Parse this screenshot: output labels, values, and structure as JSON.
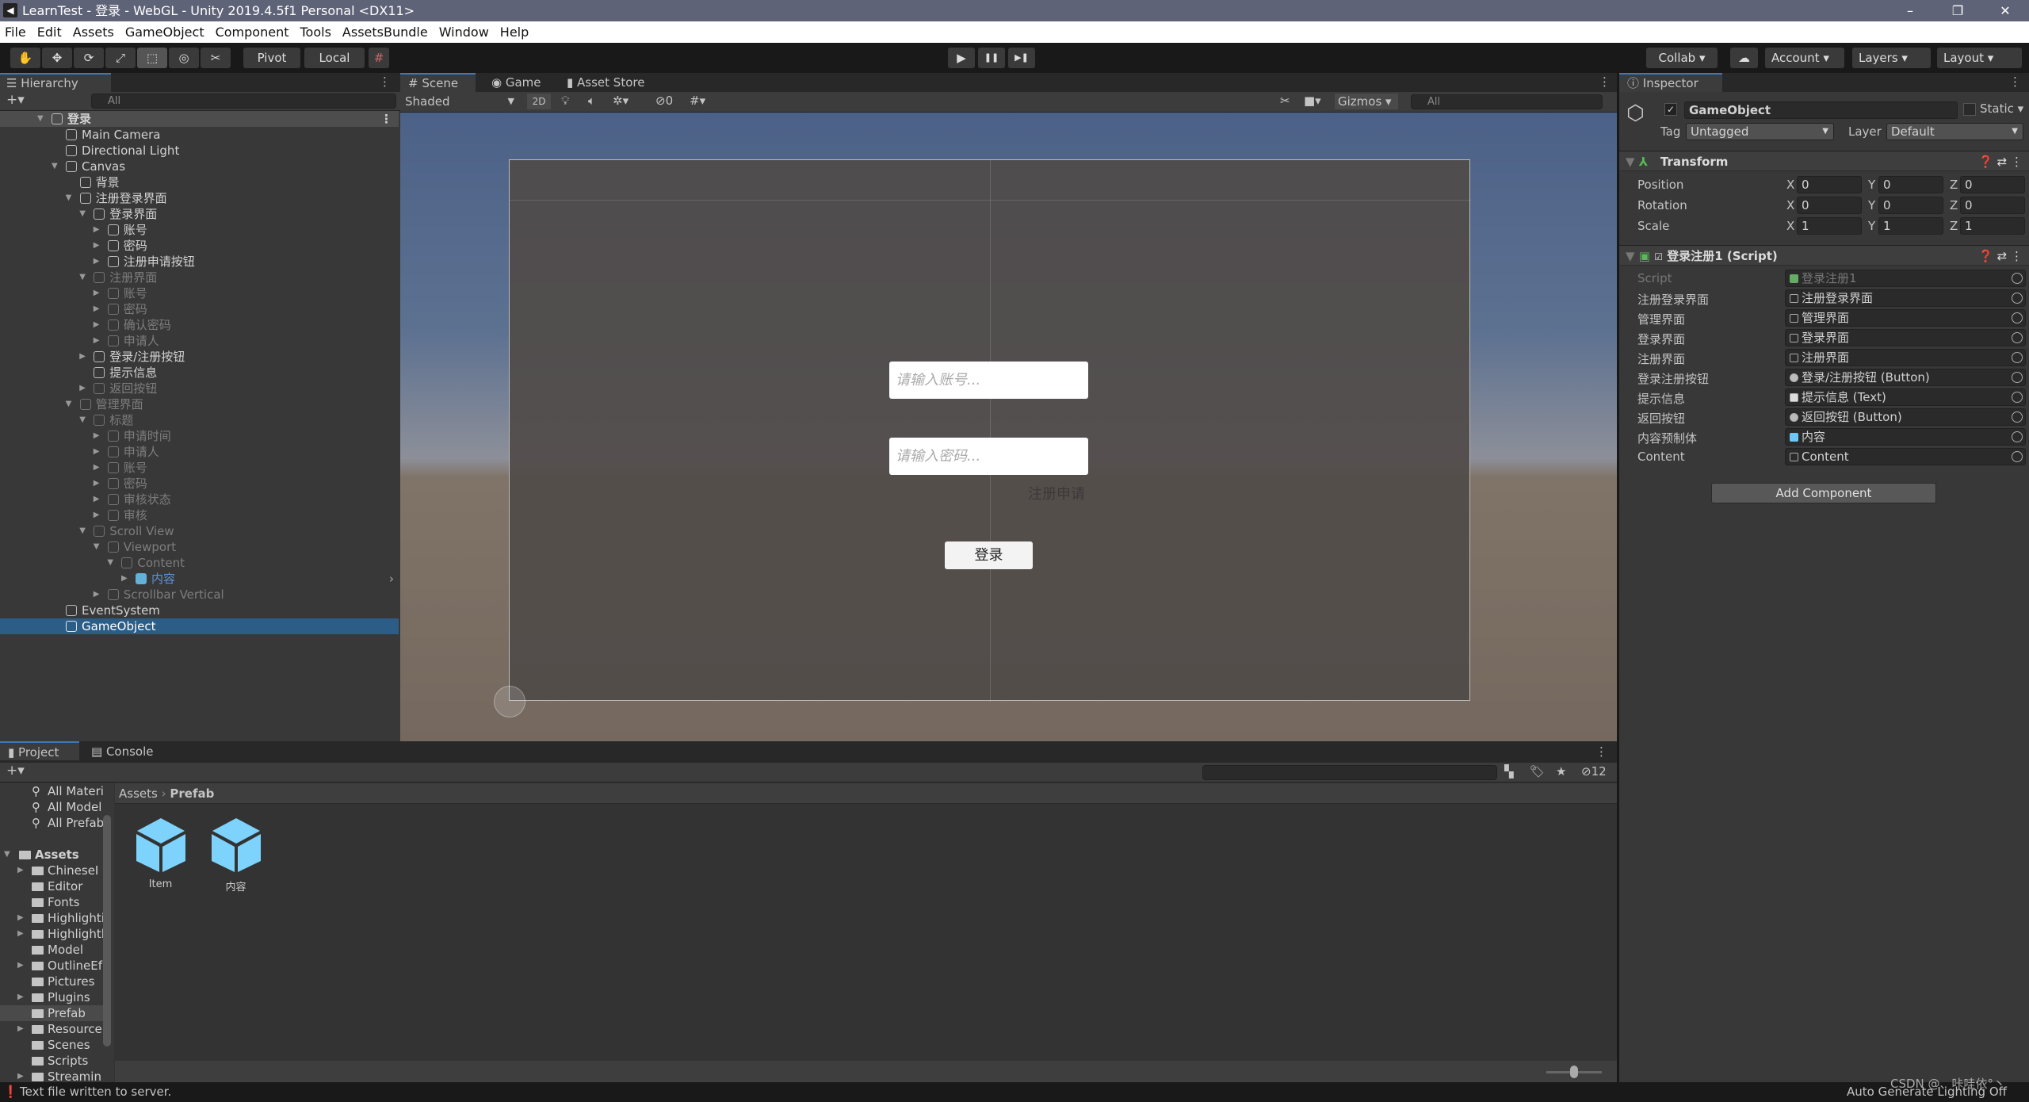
{
  "window": {
    "title": "LearnTest - 登录 - WebGL - Unity 2019.4.5f1 Personal <DX11>",
    "minimize": "–",
    "maximize": "❐",
    "close": "✕"
  },
  "menu": [
    "File",
    "Edit",
    "Assets",
    "GameObject",
    "Component",
    "Tools",
    "AssetsBundle",
    "Window",
    "Help"
  ],
  "toolbar": {
    "tools": [
      "✋",
      "✥",
      "⟳",
      "⤢",
      "⬚",
      "◎",
      "✂"
    ],
    "pivot": "Pivot",
    "local": "Local",
    "grid": "#",
    "play": "▶",
    "pause": "❚❚",
    "step": "▶❚",
    "collab": "Collab ▾",
    "cloud": "☁",
    "account": "Account",
    "layers": "Layers",
    "layout": "Layout"
  },
  "hierarchy": {
    "tab": "Hierarchy",
    "search_placeholder": "All",
    "add": "+▾",
    "items": [
      {
        "label": "登录",
        "depth": 0,
        "arrow": "open",
        "root": true
      },
      {
        "label": "Main Camera",
        "depth": 1
      },
      {
        "label": "Directional Light",
        "depth": 1
      },
      {
        "label": "Canvas",
        "depth": 1,
        "arrow": "open"
      },
      {
        "label": "背景",
        "depth": 2
      },
      {
        "label": "注册登录界面",
        "depth": 2,
        "arrow": "open"
      },
      {
        "label": "登录界面",
        "depth": 3,
        "arrow": "open"
      },
      {
        "label": "账号",
        "depth": 4,
        "arrow": "closed"
      },
      {
        "label": "密码",
        "depth": 4,
        "arrow": "closed"
      },
      {
        "label": "注册申请按钮",
        "depth": 4,
        "arrow": "closed"
      },
      {
        "label": "注册界面",
        "depth": 3,
        "arrow": "open",
        "dim": true
      },
      {
        "label": "账号",
        "depth": 4,
        "arrow": "closed",
        "dim": true
      },
      {
        "label": "密码",
        "depth": 4,
        "arrow": "closed",
        "dim": true
      },
      {
        "label": "确认密码",
        "depth": 4,
        "arrow": "closed",
        "dim": true
      },
      {
        "label": "申请人",
        "depth": 4,
        "arrow": "closed",
        "dim": true
      },
      {
        "label": "登录/注册按钮",
        "depth": 3,
        "arrow": "closed"
      },
      {
        "label": "提示信息",
        "depth": 3
      },
      {
        "label": "返回按钮",
        "depth": 3,
        "arrow": "closed",
        "dim": true
      },
      {
        "label": "管理界面",
        "depth": 2,
        "arrow": "open",
        "dim": true
      },
      {
        "label": "标题",
        "depth": 3,
        "arrow": "open",
        "dim": true
      },
      {
        "label": "申请时间",
        "depth": 4,
        "arrow": "closed",
        "dim": true
      },
      {
        "label": "申请人",
        "depth": 4,
        "arrow": "closed",
        "dim": true
      },
      {
        "label": "账号",
        "depth": 4,
        "arrow": "closed",
        "dim": true
      },
      {
        "label": "密码",
        "depth": 4,
        "arrow": "closed",
        "dim": true
      },
      {
        "label": "审核状态",
        "depth": 4,
        "arrow": "closed",
        "dim": true
      },
      {
        "label": "审核",
        "depth": 4,
        "arrow": "closed",
        "dim": true
      },
      {
        "label": "Scroll View",
        "depth": 3,
        "arrow": "open",
        "dim": true
      },
      {
        "label": "Viewport",
        "depth": 4,
        "arrow": "open",
        "dim": true
      },
      {
        "label": "Content",
        "depth": 5,
        "arrow": "open",
        "dim": true
      },
      {
        "label": "内容",
        "depth": 6,
        "arrow": "closed",
        "prefab": true
      },
      {
        "label": "Scrollbar Vertical",
        "depth": 4,
        "arrow": "closed",
        "dim": true
      },
      {
        "label": "EventSystem",
        "depth": 1
      },
      {
        "label": "GameObject",
        "depth": 1,
        "selected": true
      }
    ]
  },
  "scene": {
    "tabs": [
      "# Scene",
      "Game",
      "Asset Store"
    ],
    "shading": "Shaded",
    "mode_2d": "2D",
    "hidden_count": "0",
    "gizmos": "Gizmos",
    "search_placeholder": "All",
    "ui": {
      "account_placeholder": "请输入账号...",
      "password_placeholder": "请输入密码...",
      "register_link": "注册申请",
      "login_button": "登录"
    }
  },
  "inspector": {
    "tab": "Inspector",
    "object_name": "GameObject",
    "active": true,
    "static_label": "Static",
    "tag_label": "Tag",
    "tag": "Untagged",
    "layer_label": "Layer",
    "layer": "Default",
    "transform": {
      "title": "Transform",
      "rows": [
        {
          "label": "Position",
          "x": "0",
          "y": "0",
          "z": "0"
        },
        {
          "label": "Rotation",
          "x": "0",
          "y": "0",
          "z": "0"
        },
        {
          "label": "Scale",
          "x": "1",
          "y": "1",
          "z": "1"
        }
      ]
    },
    "script": {
      "title": "登录注册1 (Script)",
      "fields": [
        {
          "label": "Script",
          "value": "登录注册1",
          "icon": "script"
        },
        {
          "label": "注册登录界面",
          "value": "注册登录界面",
          "icon": "gameobject"
        },
        {
          "label": "管理界面",
          "value": "管理界面",
          "icon": "gameobject"
        },
        {
          "label": "登录界面",
          "value": "登录界面",
          "icon": "gameobject"
        },
        {
          "label": "注册界面",
          "value": "注册界面",
          "icon": "gameobject"
        },
        {
          "label": "登录注册按钮",
          "value": "登录/注册按钮 (Button)",
          "icon": "button"
        },
        {
          "label": "提示信息",
          "value": "提示信息 (Text)",
          "icon": "text"
        },
        {
          "label": "返回按钮",
          "value": "返回按钮 (Button)",
          "icon": "button"
        },
        {
          "label": "内容预制体",
          "value": "内容",
          "icon": "prefab"
        },
        {
          "label": "Content",
          "value": "Content",
          "icon": "gameobject"
        }
      ]
    },
    "add_component": "Add Component"
  },
  "project": {
    "tabs": [
      "Project",
      "Console"
    ],
    "hidden_count": "12",
    "tree": [
      {
        "label": "All Materi",
        "search": true
      },
      {
        "label": "All Model",
        "search": true
      },
      {
        "label": "All Prefab",
        "search": true
      },
      {
        "label": ""
      },
      {
        "label": "Assets",
        "root": true
      },
      {
        "label": "ChineseI",
        "arrow": true
      },
      {
        "label": "Editor"
      },
      {
        "label": "Fonts"
      },
      {
        "label": "Highlighti",
        "arrow": true
      },
      {
        "label": "Highlightl",
        "arrow": true
      },
      {
        "label": "Model"
      },
      {
        "label": "OutlineEf",
        "arrow": true
      },
      {
        "label": "Pictures"
      },
      {
        "label": "Plugins",
        "arrow": true
      },
      {
        "label": "Prefab",
        "selected": true
      },
      {
        "label": "Resource",
        "arrow": true
      },
      {
        "label": "Scenes"
      },
      {
        "label": "Scripts"
      },
      {
        "label": "Streamin",
        "arrow": true
      }
    ],
    "breadcrumb": [
      "Assets",
      "Prefab"
    ],
    "items": [
      "Item",
      "内容"
    ]
  },
  "status": {
    "message": "Text file written to server.",
    "right": "Auto Generate Lighting Off",
    "watermark": "CSDN @、咔哇依°丶"
  },
  "colors": {
    "selection": "#2c5d87",
    "accent": "#3a79bb",
    "prefab": "#6cc7f5"
  }
}
